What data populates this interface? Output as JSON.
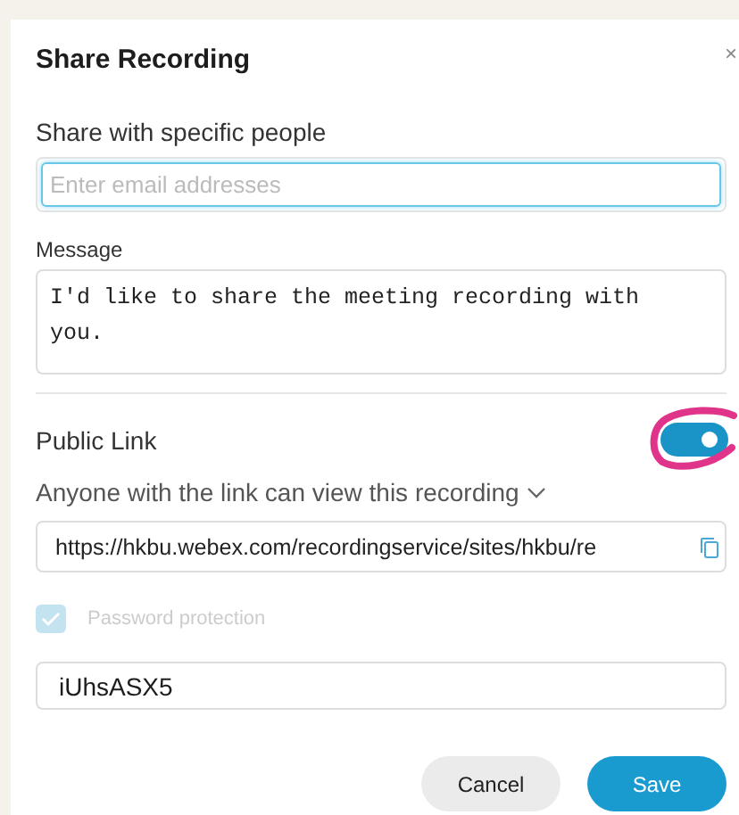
{
  "dialog": {
    "title": "Share Recording",
    "close_icon": "×"
  },
  "share": {
    "label": "Share with specific people",
    "placeholder": "Enter email addresses",
    "focused": true
  },
  "message": {
    "label": "Message",
    "value": "I'd like to share the meeting recording with you."
  },
  "public_link": {
    "label": "Public Link",
    "on": true,
    "access": "Anyone with the link can view this recording",
    "url": "https://hkbu.webex.com/recordingservice/sites/hkbu/re"
  },
  "password_protection": {
    "label": "Password protection",
    "checked": true,
    "disabled": true
  },
  "password": {
    "value": "iUhsASX5"
  },
  "buttons": [
    {
      "label": "Cancel",
      "kind": "secondary"
    },
    {
      "label": "Save",
      "kind": "primary"
    }
  ]
}
